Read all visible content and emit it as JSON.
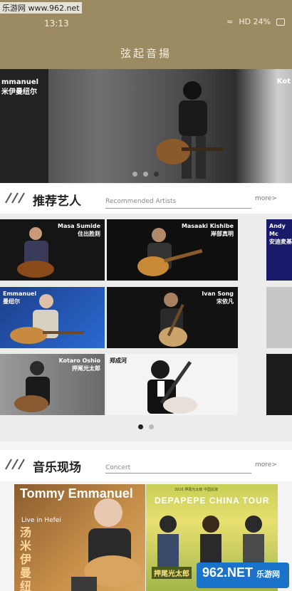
{
  "watermark": "乐游网 www.962.net",
  "status": {
    "time": "13:13",
    "right": "HD 24%"
  },
  "app_title": "弦起音揚",
  "hero": {
    "left_label_1": "mmanuel",
    "left_label_2": "米伊曼纽尔",
    "right_label": "Kot",
    "dots": 3,
    "active_dot": 2
  },
  "artists_section": {
    "title": "推荐艺人",
    "subtitle": "Recommended Artists",
    "more": "more>"
  },
  "artists": [
    {
      "name_en": "Masa Sumide",
      "name_cn": "住出胜则"
    },
    {
      "name_en": "Masaaki Kishibe",
      "name_cn": "岸部真明"
    },
    {
      "name_en": "Andy Mc",
      "name_cn": "安迪麦基"
    },
    {
      "name_en": "Emmanuel",
      "name_cn": "曼纽尔"
    },
    {
      "name_en": "Ivan Song",
      "name_cn": "宋依凡"
    },
    {
      "name_en": "Kotaro Oshio",
      "name_cn": "押尾光太郎"
    },
    {
      "name_en": "",
      "name_cn": "郑成河"
    }
  ],
  "concert_section": {
    "title": "音乐现场",
    "subtitle": "Concert",
    "more": "more>"
  },
  "posters": {
    "p1_title": "Tommy Emmanuel",
    "p1_sub": "Live in Hefei",
    "p1_cn": "汤米伊曼纽尔",
    "p2_small": "2016 押尾光太郎 中国巡演",
    "p2_title": "DEPAPEPE CHINA TOUR",
    "p2_name": "押尾光太郎"
  },
  "logo": {
    "main": "962.NET",
    "sub": "乐游网"
  }
}
